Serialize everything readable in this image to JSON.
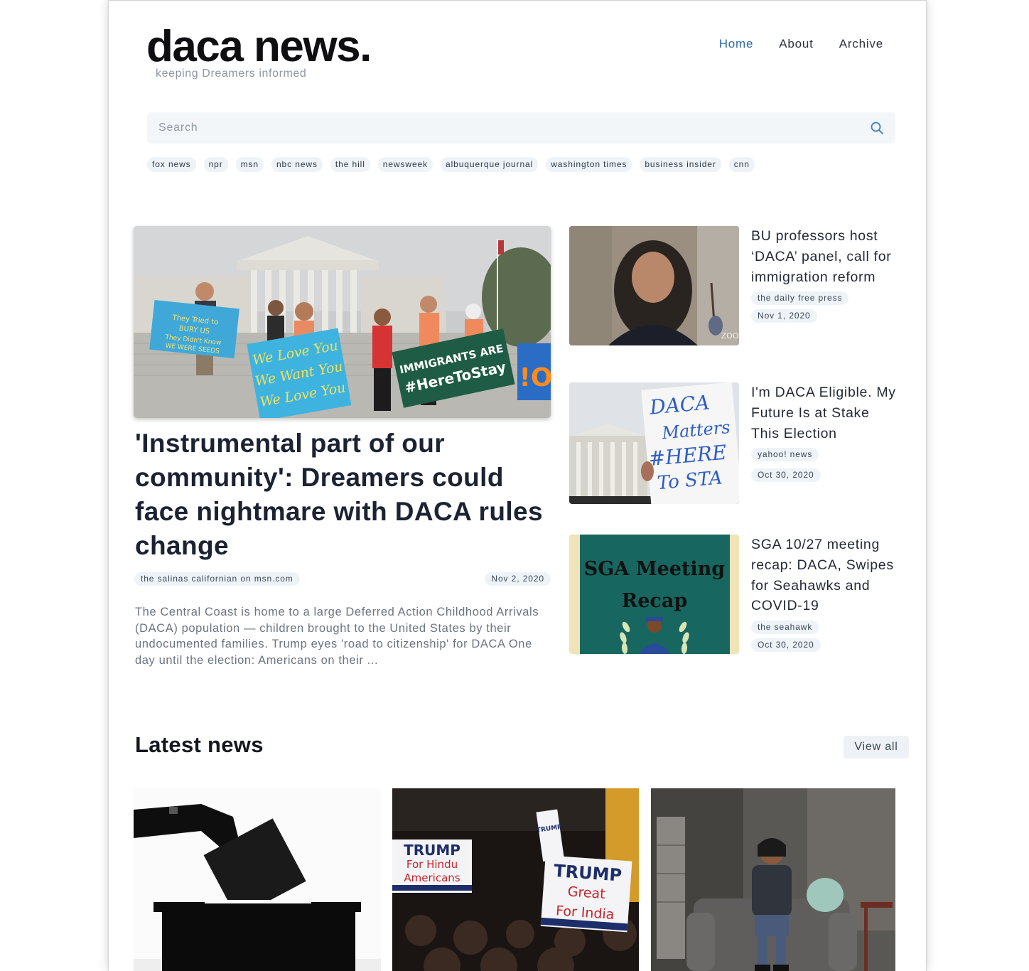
{
  "brand": {
    "logo": "daca news.",
    "tagline": "keeping Dreamers informed"
  },
  "nav": {
    "items": [
      {
        "label": "Home",
        "active": true
      },
      {
        "label": "About",
        "active": false
      },
      {
        "label": "Archive",
        "active": false
      }
    ]
  },
  "search": {
    "placeholder": "Search",
    "value": ""
  },
  "source_tags": [
    "fox news",
    "npr",
    "msn",
    "nbc news",
    "the hill",
    "newsweek",
    "albuquerque journal",
    "washington times",
    "business insider",
    "cnn"
  ],
  "featured": {
    "title": "'Instrumental part of our community': Dreamers could face nightmare with DACA rules change",
    "source": "the salinas californian on msn.com",
    "date": "Nov 2, 2020",
    "excerpt": "The Central Coast is home to a large Deferred Action Childhood Arrivals (DACA) population — children brought to the United States by their undocumented families. Trump eyes 'road to citizenship' for DACA One day until the election: Americans on their ...",
    "image_text": {
      "sign_left": "They Tried to BURY US They Didn't Know WE WERE SEEDS",
      "sign_middle": "We Love You We Want You We Love You",
      "sign_right": "IMMIGRANTS ARE #HereToStay"
    }
  },
  "side_stories": [
    {
      "title": "BU professors host ‘DACA’ panel, call for immigration reform",
      "source": "the daily free press",
      "date": "Nov 1, 2020",
      "image_text": "ZOO"
    },
    {
      "title": "I'm DACA Eligible. My Future Is at Stake This Election",
      "source": "yahoo! news",
      "date": "Oct 30, 2020",
      "image_text": "DACA Matters #HERE To STA"
    },
    {
      "title": "SGA 10/27 meeting recap: DACA, Swipes for Seahawks and COVID-19",
      "source": "the seahawk",
      "date": "Oct 30, 2020",
      "image_text": "SGA Meeting Recap"
    }
  ],
  "latest": {
    "heading": "Latest news",
    "view_all_label": "View all",
    "cards": [
      {
        "image": "ballot-box-silhouette"
      },
      {
        "image": "trump-rally-signs",
        "image_text": [
          "TRUMP",
          "For Hindu",
          "Americans",
          "TRUMP",
          "Great",
          "For India"
        ]
      },
      {
        "image": "person-seated-in-armchair"
      }
    ]
  },
  "colors": {
    "accent": "#2f6aa6",
    "pill_bg": "#eef3f8",
    "search_bg": "#f3f6f9",
    "muted_text": "#6b7482"
  }
}
